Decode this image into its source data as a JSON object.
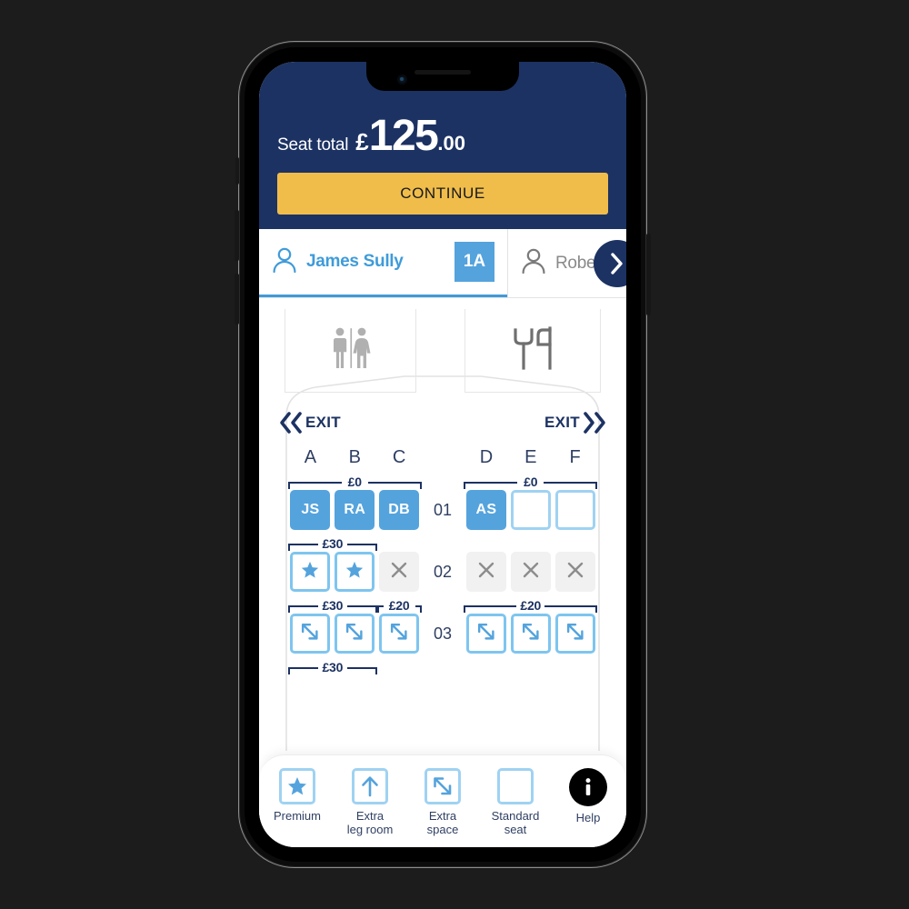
{
  "header": {
    "total_label": "Seat total",
    "currency": "£",
    "amount": "125",
    "decimals": ".00",
    "continue_label": "CONTINUE",
    "bg_color": "#1c3263",
    "continue_color": "#f0bd4b"
  },
  "passengers": {
    "active": {
      "name": "James Sully",
      "seat": "1A",
      "icon": "person-icon",
      "accent_color": "#3f9bd9"
    },
    "inactive": {
      "name": "Robert",
      "icon": "person-icon"
    },
    "next_button_icon": "chevron-right-icon"
  },
  "cabin": {
    "lavatory_icon": "lavatory-icon",
    "galley_icon": "galley-icon",
    "exit_left_label": "EXIT",
    "exit_right_label": "EXIT",
    "columns": [
      "A",
      "B",
      "C",
      "D",
      "E",
      "F"
    ],
    "rows": [
      {
        "number": "01",
        "brackets_above_left": [
          {
            "price": "£0",
            "span": 3
          }
        ],
        "brackets_above_right": [
          {
            "price": "£0",
            "span": 3
          }
        ],
        "seats": [
          {
            "col": "A",
            "state": "occupied",
            "label": "JS"
          },
          {
            "col": "B",
            "state": "occupied",
            "label": "RA"
          },
          {
            "col": "C",
            "state": "occupied",
            "label": "DB"
          },
          {
            "col": "D",
            "state": "occupied",
            "label": "AS"
          },
          {
            "col": "E",
            "state": "standard",
            "label": ""
          },
          {
            "col": "F",
            "state": "standard",
            "label": ""
          }
        ]
      },
      {
        "number": "02",
        "brackets_above_left": [
          {
            "price": "£30",
            "span": 2
          }
        ],
        "brackets_above_right": [],
        "seats": [
          {
            "col": "A",
            "state": "premium",
            "label": ""
          },
          {
            "col": "B",
            "state": "premium",
            "label": ""
          },
          {
            "col": "C",
            "state": "unavailable",
            "label": ""
          },
          {
            "col": "D",
            "state": "unavailable",
            "label": ""
          },
          {
            "col": "E",
            "state": "unavailable",
            "label": ""
          },
          {
            "col": "F",
            "state": "unavailable",
            "label": ""
          }
        ]
      },
      {
        "number": "03",
        "brackets_above_left": [
          {
            "price": "£30",
            "span": 2
          },
          {
            "price": "£20",
            "span": 1
          }
        ],
        "brackets_above_right": [
          {
            "price": "£20",
            "span": 3
          }
        ],
        "seats": [
          {
            "col": "A",
            "state": "space",
            "label": ""
          },
          {
            "col": "B",
            "state": "space",
            "label": ""
          },
          {
            "col": "C",
            "state": "space",
            "label": ""
          },
          {
            "col": "D",
            "state": "space",
            "label": ""
          },
          {
            "col": "E",
            "state": "space",
            "label": ""
          },
          {
            "col": "F",
            "state": "space",
            "label": ""
          }
        ]
      }
    ],
    "partial_bracket_below": {
      "price": "£30",
      "span": 2
    }
  },
  "legend": {
    "items": [
      {
        "icon": "premium-star-icon",
        "label": "Premium"
      },
      {
        "icon": "extra-leg-room-arrow-icon",
        "label": "Extra\nleg room"
      },
      {
        "icon": "extra-space-diagonal-icon",
        "label": "Extra\nspace"
      },
      {
        "icon": "standard-seat-icon",
        "label": "Standard\nseat"
      },
      {
        "icon": "help-info-icon",
        "label": "Help"
      }
    ]
  },
  "colors": {
    "navy": "#1c3263",
    "seat_blue": "#54a3dd",
    "seat_border": "#9fd2f2",
    "unavailable": "#f1f1f1",
    "page_bg": "#1c1c1c"
  }
}
